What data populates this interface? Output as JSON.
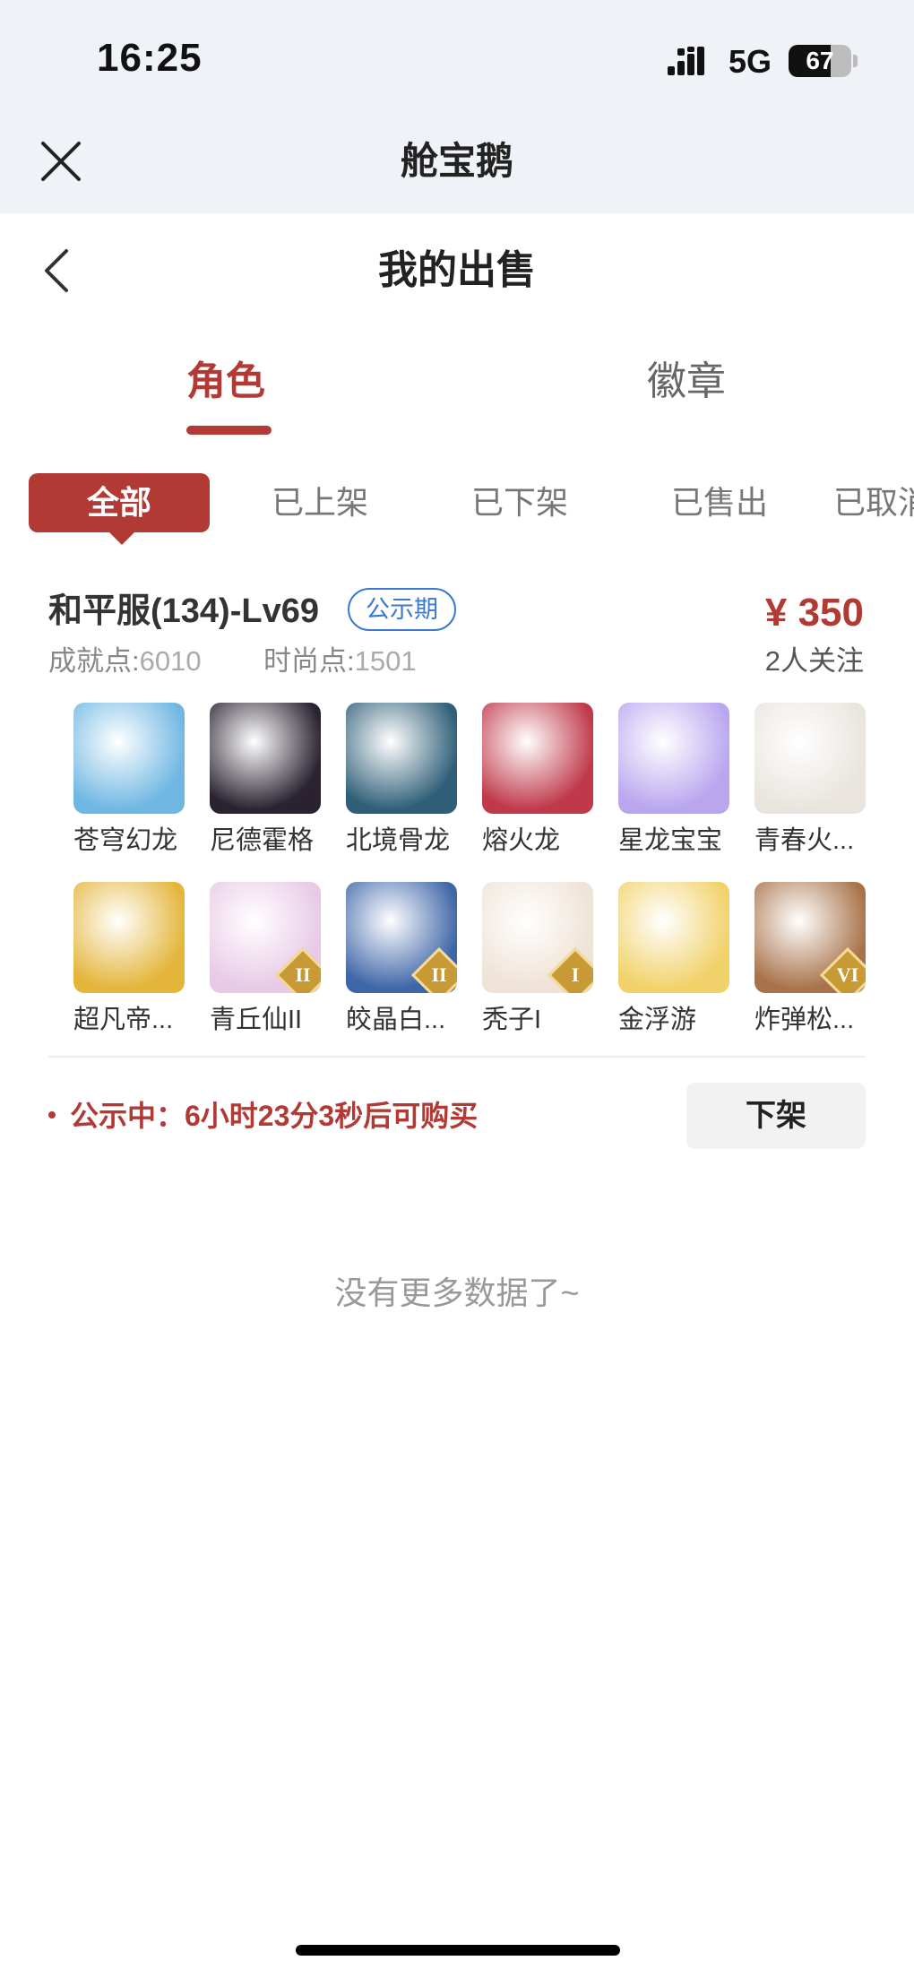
{
  "status_bar": {
    "time": "16:25",
    "network": "5G",
    "battery": "67",
    "battery_level": 0.67
  },
  "mini_program": {
    "title": "舱宝鹅"
  },
  "page": {
    "title": "我的出售"
  },
  "main_tabs": [
    {
      "label": "角色",
      "active": true
    },
    {
      "label": "徽章",
      "active": false
    }
  ],
  "filters": [
    {
      "label": "全部",
      "active": true
    },
    {
      "label": "已上架",
      "active": false
    },
    {
      "label": "已下架",
      "active": false
    },
    {
      "label": "已售出",
      "active": false
    },
    {
      "label": "已取消",
      "active": false
    }
  ],
  "listing": {
    "server": "和平服(134)-Lv69",
    "badge": "公示期",
    "price": "¥ 350",
    "followers": "2人关注",
    "achievement_label": "成就点:",
    "achievement_value": "6010",
    "fashion_label": "时尚点:",
    "fashion_value": "1501",
    "pets": [
      {
        "name": "苍穹幻龙",
        "icon": "sky-dragon-icon",
        "color": "#6fb7e3",
        "rank": ""
      },
      {
        "name": "尼德霍格",
        "icon": "dark-dragon-icon",
        "color": "#2a2230",
        "rank": ""
      },
      {
        "name": "北境骨龙",
        "icon": "bone-dragon-icon",
        "color": "#2f5f78",
        "rank": ""
      },
      {
        "name": "熔火龙",
        "icon": "fire-dragon-icon",
        "color": "#c0394a",
        "rank": ""
      },
      {
        "name": "星龙宝宝",
        "icon": "star-dragon-icon",
        "color": "#b9a6ef",
        "rank": ""
      },
      {
        "name": "青春火...",
        "icon": "white-beast-icon",
        "color": "#e9e4de",
        "rank": ""
      },
      {
        "name": "超凡帝...",
        "icon": "golden-armor-icon",
        "color": "#e3b53a",
        "rank": ""
      },
      {
        "name": "青丘仙II",
        "icon": "fox-fairy-icon",
        "color": "#e8c9e6",
        "rank": "II"
      },
      {
        "name": "皎晶白...",
        "icon": "white-tiger-icon",
        "color": "#3f66a8",
        "rank": "II"
      },
      {
        "name": "秃子I",
        "icon": "bald-head-icon",
        "color": "#efe2d6",
        "rank": "I"
      },
      {
        "name": "金浮游",
        "icon": "golden-floater-icon",
        "color": "#f1d26a",
        "rank": ""
      },
      {
        "name": "炸弹松...",
        "icon": "squirrel-icon",
        "color": "#a8734a",
        "rank": "VI"
      }
    ],
    "notice": "公示中：6小时23分3秒后可购买",
    "delist_label": "下架"
  },
  "footer": {
    "no_more": "没有更多数据了~"
  },
  "colors": {
    "accent": "#b23a35",
    "badge_blue": "#3c7ad1",
    "header_bg": "#eff2f6"
  }
}
